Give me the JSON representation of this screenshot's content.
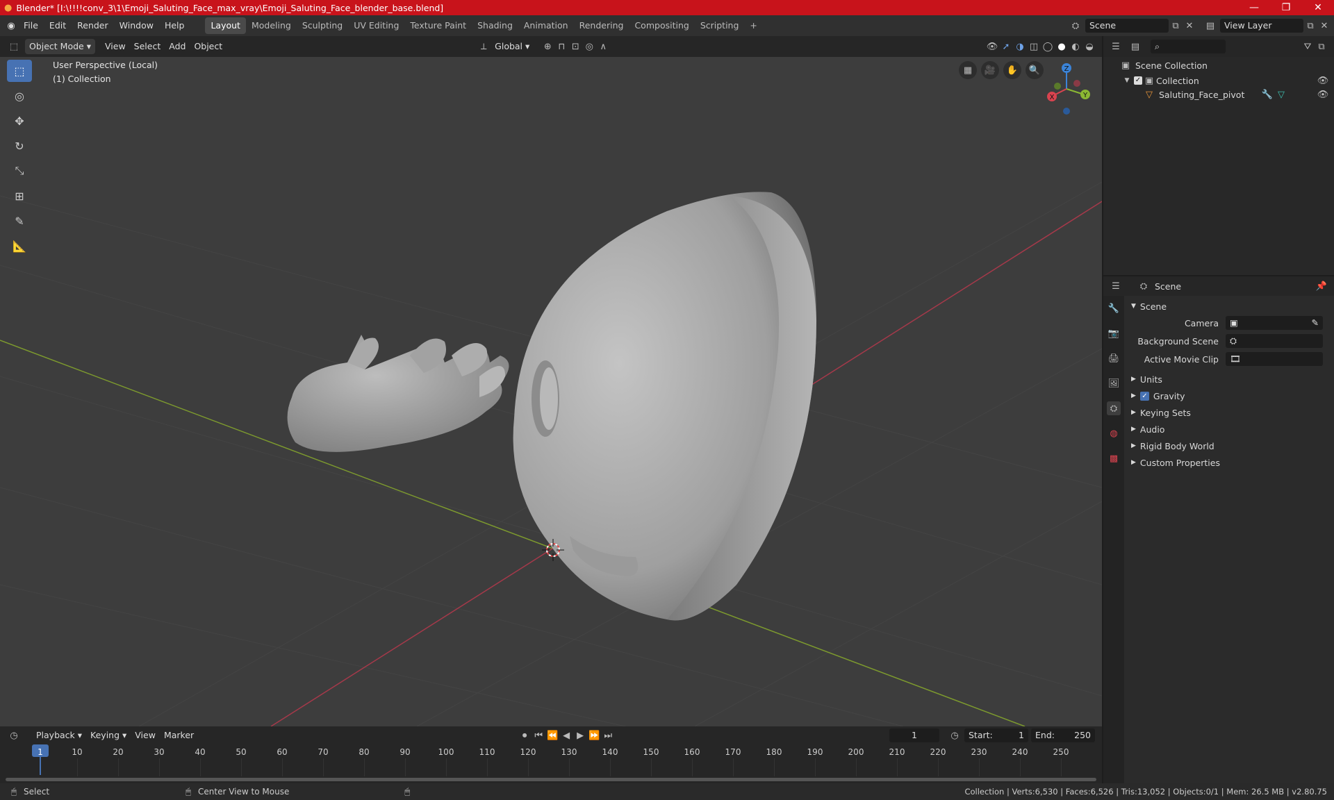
{
  "title": "Blender* [I:\\!!!!conv_3\\1\\Emoji_Saluting_Face_max_vray\\Emoji_Saluting_Face_blender_base.blend]",
  "menus": [
    "File",
    "Edit",
    "Render",
    "Window",
    "Help"
  ],
  "workspaces": [
    "Layout",
    "Modeling",
    "Sculpting",
    "UV Editing",
    "Texture Paint",
    "Shading",
    "Animation",
    "Rendering",
    "Compositing",
    "Scripting"
  ],
  "scene_field": "Scene",
  "view_layer_field": "View Layer",
  "viewport_header": {
    "mode": "Object Mode",
    "menu": [
      "View",
      "Select",
      "Add",
      "Object"
    ],
    "orientation": "Global"
  },
  "viewport_info": {
    "line1": "User Perspective (Local)",
    "line2": "(1) Collection"
  },
  "gizmo": {
    "x": "X",
    "y": "Y",
    "z": "Z"
  },
  "outliner": {
    "root": "Scene Collection",
    "collection": "Collection",
    "object": "Saluting_Face_pivot"
  },
  "properties": {
    "header": "Scene",
    "panel": "Scene",
    "fields": [
      {
        "label": "Camera"
      },
      {
        "label": "Background Scene"
      },
      {
        "label": "Active Movie Clip"
      }
    ],
    "sections": [
      "Units",
      "Gravity",
      "Keying Sets",
      "Audio",
      "Rigid Body World",
      "Custom Properties"
    ]
  },
  "timeline": {
    "menus": [
      "Playback",
      "Keying",
      "View",
      "Marker"
    ],
    "current_frame": "1",
    "start_label": "Start:",
    "start": "1",
    "end_label": "End:",
    "end": "250",
    "ticks": [
      "1",
      "10",
      "20",
      "30",
      "40",
      "50",
      "60",
      "70",
      "80",
      "90",
      "100",
      "110",
      "120",
      "130",
      "140",
      "150",
      "160",
      "170",
      "180",
      "190",
      "200",
      "210",
      "220",
      "230",
      "240",
      "250"
    ]
  },
  "status": {
    "left": "Select",
    "middle": "Center View to Mouse",
    "right": "Collection | Verts:6,530 | Faces:6,526 | Tris:13,052 | Objects:0/1 | Mem: 26.5 MB | v2.80.75"
  },
  "colors": {
    "title_bar": "#c8131b",
    "active_tool": "#4772b3",
    "viewport": "#3d3d3d",
    "x_axis": "#d9434f",
    "y_axis": "#8bb833",
    "z_axis": "#3b84d9"
  }
}
